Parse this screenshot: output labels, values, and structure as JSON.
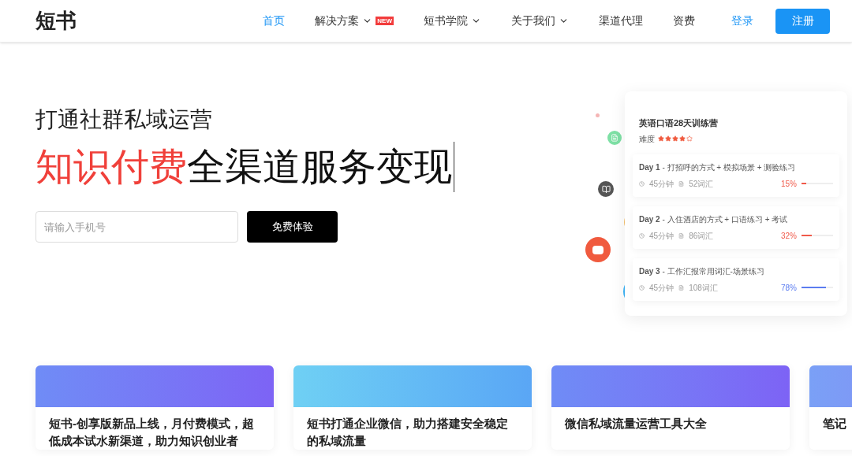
{
  "nav": {
    "logo": "短书",
    "items": [
      {
        "label": "首页",
        "selected": true,
        "dropdown": false
      },
      {
        "label": "解决方案",
        "selected": false,
        "dropdown": true,
        "badge": "NEW"
      },
      {
        "label": "短书学院",
        "selected": false,
        "dropdown": true
      },
      {
        "label": "关于我们",
        "selected": false,
        "dropdown": true
      },
      {
        "label": "渠道代理",
        "selected": false,
        "dropdown": false
      },
      {
        "label": "资费",
        "selected": false,
        "dropdown": false
      }
    ],
    "login": "登录",
    "register": "注册"
  },
  "hero": {
    "subtitle": "打通社群私域运营",
    "headline_highlight": "知识付费",
    "headline_rest": "全渠道服务变现",
    "phone_placeholder": "请输入手机号",
    "cta": "免费体验"
  },
  "course_card": {
    "title": "英语口语28天训练营",
    "difficulty_label": "难度",
    "stars": 4,
    "days": [
      {
        "title_day": "Day 1",
        "title_rest": " - 打招呼的方式 + 模拟场景 + 测验练习",
        "duration": "45分钟",
        "words": "52词汇",
        "percent": "15%",
        "level": 0.15,
        "color": "#f05a4a"
      },
      {
        "title_day": "Day 2",
        "title_rest": " - 入住酒店的方式 + 口语练习 + 考试",
        "duration": "45分钟",
        "words": "86词汇",
        "percent": "32%",
        "level": 0.32,
        "color": "#f05a4a"
      },
      {
        "title_day": "Day 3",
        "title_rest": " - 工作汇报常用词汇-场景练习",
        "duration": "45分钟",
        "words": "108词汇",
        "percent": "78%",
        "level": 0.78,
        "color": "#5b7cf0"
      }
    ]
  },
  "articles": [
    {
      "title": "短书-创享版新品上线，月付费模式，超低成本试水新渠道，助力知识创业者"
    },
    {
      "title": "短书打通企业微信，助力搭建安全稳定的私域流量"
    },
    {
      "title": "微信私域流量运营工具大全"
    },
    {
      "title": "笔记"
    }
  ]
}
